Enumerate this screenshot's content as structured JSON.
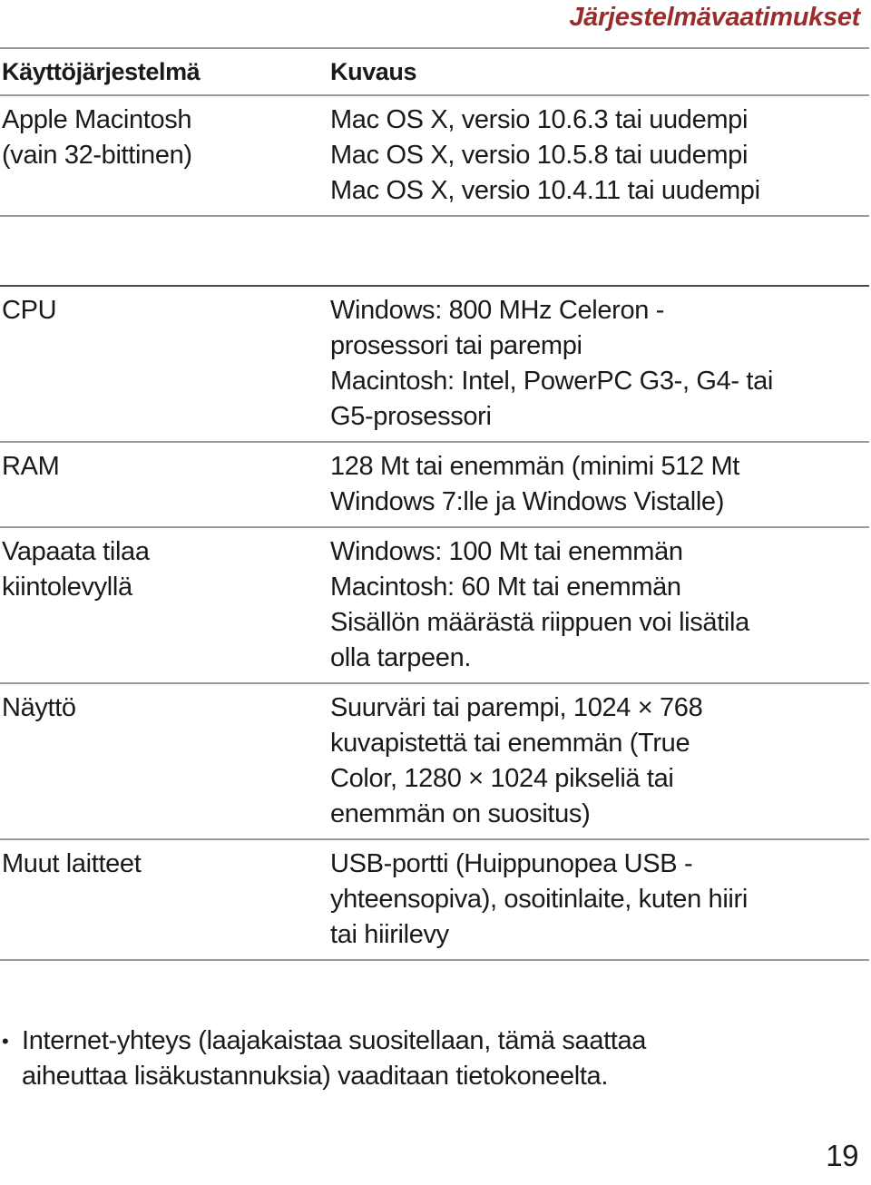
{
  "header": {
    "running_title": "Järjestelmävaatimukset",
    "accent_color": "#9c2b2b"
  },
  "table": {
    "columns": [
      {
        "key": "os",
        "header": "Käyttöjärjestelmä"
      },
      {
        "key": "desc",
        "header": "Kuvaus"
      }
    ],
    "rows": [
      {
        "label_lines": [
          "Apple Macintosh",
          "(vain 32-bittinen)"
        ],
        "desc_lines": [
          "Mac OS X, versio 10.6.3 tai uudempi",
          "Mac OS X, versio 10.5.8 tai uudempi",
          "Mac OS X, versio 10.4.11 tai uudempi"
        ]
      },
      {
        "label_lines": [
          "CPU"
        ],
        "desc_lines": [
          "Windows: 800 MHz Celeron -",
          "prosessori tai parempi",
          "Macintosh: Intel, PowerPC G3-, G4- tai",
          "G5-prosessori"
        ]
      },
      {
        "label_lines": [
          "RAM"
        ],
        "desc_lines": [
          "128 Mt tai enemmän (minimi 512 Mt",
          "Windows 7:lle ja Windows Vistalle)"
        ]
      },
      {
        "label_lines": [
          "Vapaata tilaa",
          "kiintolevyllä"
        ],
        "desc_lines": [
          "Windows: 100 Mt tai enemmän",
          "Macintosh: 60 Mt tai enemmän",
          "Sisällön määrästä riippuen voi lisätila",
          "olla tarpeen."
        ]
      },
      {
        "label_lines": [
          "Näyttö"
        ],
        "desc_lines": [
          "Suurväri tai parempi, 1024 × 768",
          "kuvapistettä tai enemmän (True",
          "Color, 1280 × 1024 pikseliä tai",
          "enemmän on suositus)"
        ]
      },
      {
        "label_lines": [
          "Muut laitteet"
        ],
        "desc_lines": [
          "USB-portti (Huippunopea USB -",
          "yhteensopiva), osoitinlaite, kuten hiiri",
          "tai hiirilevy"
        ]
      }
    ]
  },
  "footnote": {
    "bullet_glyph": "•",
    "lines": [
      "Internet-yhteys (laajakaistaa suositellaan, tämä saattaa",
      "aiheuttaa lisäkustannuksia) vaaditaan tietokoneelta."
    ]
  },
  "page_number": "19"
}
